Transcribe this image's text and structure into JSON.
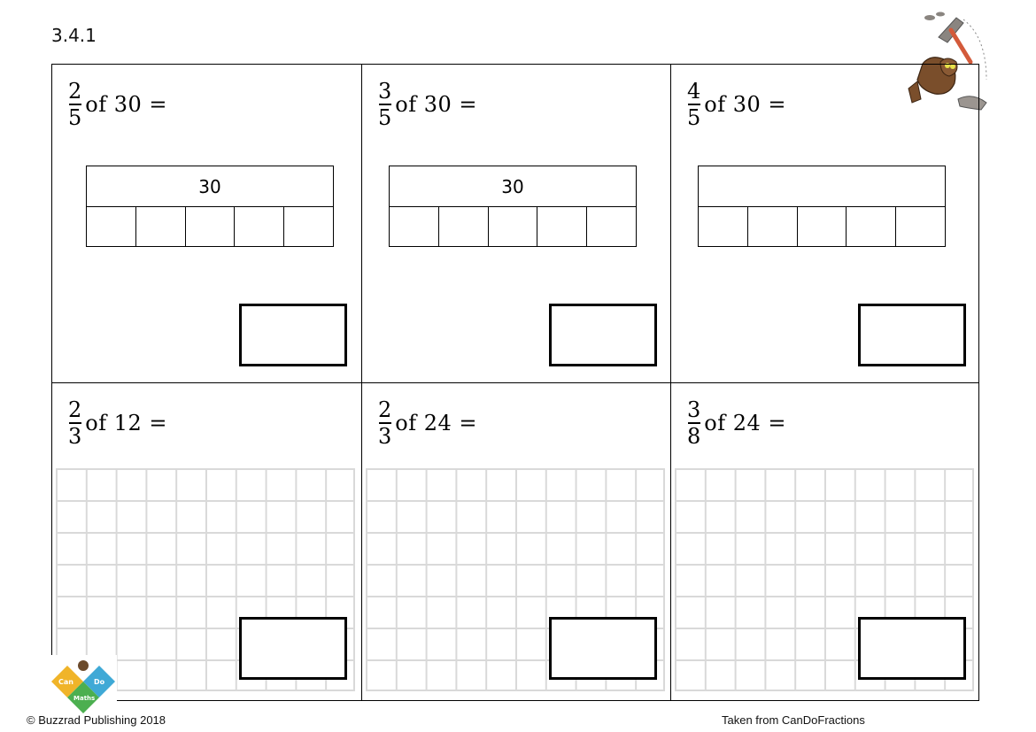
{
  "page_code": "3.4.1",
  "questions": [
    {
      "numerator": "2",
      "denominator": "5",
      "text": "of 30 =",
      "bar_total": "30",
      "bar_parts": 5,
      "support": "bar-model"
    },
    {
      "numerator": "3",
      "denominator": "5",
      "text": "of 30 =",
      "bar_total": "30",
      "bar_parts": 5,
      "support": "bar-model"
    },
    {
      "numerator": "4",
      "denominator": "5",
      "text": "of 30 =",
      "bar_total": "",
      "bar_parts": 5,
      "support": "bar-model"
    },
    {
      "numerator": "2",
      "denominator": "3",
      "text": "of 12 =",
      "support": "squared-grid"
    },
    {
      "numerator": "2",
      "denominator": "3",
      "text": "of 24 =",
      "support": "squared-grid"
    },
    {
      "numerator": "3",
      "denominator": "8",
      "text": "of 24 =",
      "support": "squared-grid"
    }
  ],
  "logo": {
    "words": [
      "Can",
      "Do",
      "Maths"
    ],
    "colors": {
      "can": "#f0b429",
      "do": "#3fa9d6",
      "maths": "#4caf50"
    }
  },
  "footer": {
    "copyright": "© Buzzrad Publishing 2018",
    "source": "Taken from CanDoFractions"
  }
}
